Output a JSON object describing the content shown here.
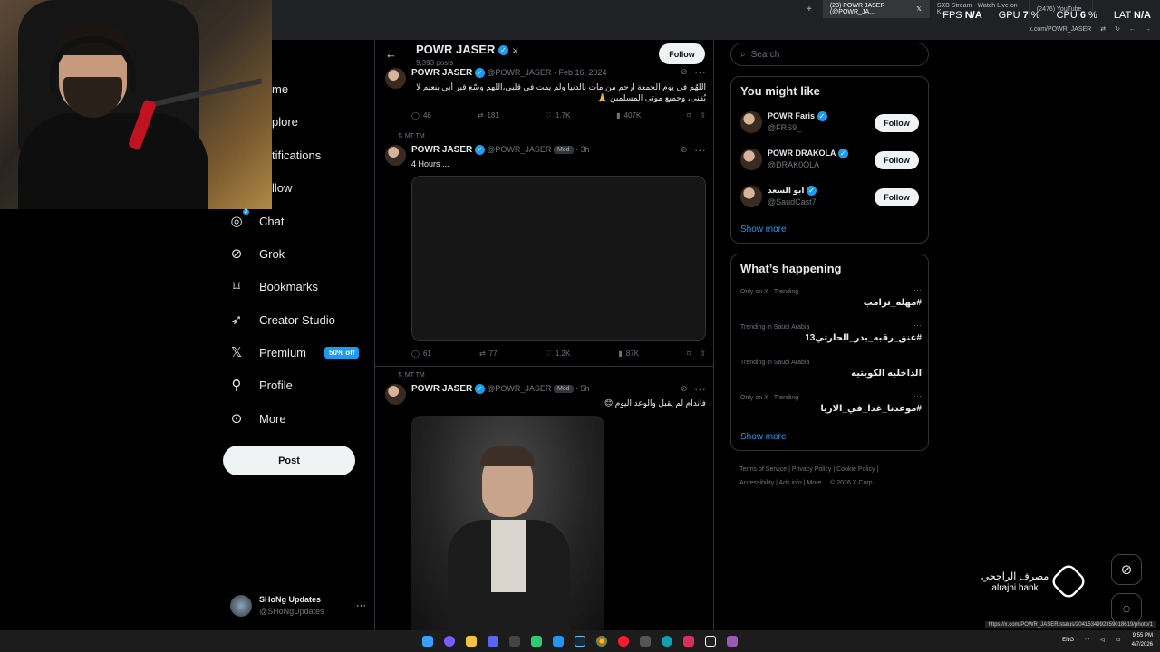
{
  "browser": {
    "tabs": [
      {
        "label": "(23) POWR JASER (@POWR_JA...",
        "active": true
      },
      {
        "label": "SXB Stream - Watch Live on K...",
        "active": false
      },
      {
        "label": "(2476) YouTube",
        "active": false
      }
    ],
    "url": "x.com/POWR_JASER",
    "hover_url": "https://x.com/POWR_JASER/status/2041534992359018619/photo/1",
    "stats": {
      "fps_label": "FPS",
      "fps": "N/A",
      "gpu_label": "GPU",
      "gpu": "7",
      "gpu_unit": "%",
      "cpu_label": "CPU",
      "cpu": "6",
      "cpu_unit": "%",
      "lat_label": "LAT",
      "lat": "N/A"
    }
  },
  "nav": {
    "items": [
      {
        "label": "me",
        "icon": "home-icon"
      },
      {
        "label": "plore",
        "icon": "explore-icon"
      },
      {
        "label": "tifications",
        "icon": "bell-icon"
      },
      {
        "label": "llow",
        "icon": "follow-icon"
      },
      {
        "label": "Chat",
        "icon": "chat-icon"
      },
      {
        "label": "Grok",
        "icon": "grok-icon"
      },
      {
        "label": "Bookmarks",
        "icon": "bookmark-icon"
      },
      {
        "label": "Creator Studio",
        "icon": "rocket-icon"
      },
      {
        "label": "Premium",
        "icon": "x-logo-icon",
        "badge": "50% off"
      },
      {
        "label": "Profile",
        "icon": "person-icon"
      },
      {
        "label": "More",
        "icon": "more-circle-icon"
      }
    ],
    "chat_badge": "3",
    "post_label": "Post",
    "account": {
      "name": "SHoNg Updates",
      "handle": "@SHoNgUpdates"
    }
  },
  "profile_header": {
    "name": "POWR JASER",
    "posts": "9,393 posts",
    "follow_label": "Follow"
  },
  "tweets": [
    {
      "name": "POWR JASER",
      "handle": "@POWR_JASER",
      "time": "Feb 16, 2024",
      "text": "اللهُم في يوم الجمعة ارحم من مات بالدنيا ولم يمت في قلبي،اللهم وسّع قبر أبي بنعيم لا يُفنى، وجميع موتى المسلمين 🙏",
      "replies": "46",
      "reposts": "181",
      "likes": "1.7K",
      "views": "407K"
    },
    {
      "repost_label": "MT TM",
      "name": "POWR JASER",
      "handle": "@POWR_JASER",
      "chip": "Mod",
      "time": "3h",
      "text": "4 Hours ...",
      "replies": "61",
      "reposts": "77",
      "likes": "1.2K",
      "views": "87K"
    },
    {
      "repost_label": "MT TM",
      "name": "POWR JASER",
      "handle": "@POWR_JASER",
      "chip": "Mod",
      "time": "5h",
      "text": "فاندام لم يقبل والوعد اليوم 😊"
    }
  ],
  "search": {
    "placeholder": "Search"
  },
  "you_might_like": {
    "title": "You might like",
    "users": [
      {
        "name": "POWR Faris",
        "handle": "@FRS9_",
        "button": "Follow"
      },
      {
        "name": "POWR DRAKOLA",
        "handle": "@DRAK0OLA",
        "button": "Follow"
      },
      {
        "name": "ابو السعد",
        "handle": "@SaudCast7",
        "button": "Follow"
      }
    ],
    "show_more": "Show more"
  },
  "whats_happening": {
    "title": "What’s happening",
    "trends": [
      {
        "context": "Only on X · Trending",
        "topic": "#مهله_ترامب"
      },
      {
        "context": "Trending in Saudi Arabia",
        "topic": "#عنق_رقبه_بدر_الحارثي13"
      },
      {
        "context": "Trending in Saudi Arabia",
        "topic": "الداخليه الكويتيه"
      },
      {
        "context": "Only on X · Trending",
        "topic": "#موعدنا_غدا_في_الاريا"
      }
    ],
    "show_more": "Show more"
  },
  "footer": {
    "links": [
      "Terms of Service",
      "Privacy Policy",
      "Cookie Policy",
      "Accessibility",
      "Ads info",
      "More ...",
      "© 2026 X Corp."
    ]
  },
  "sponsor": {
    "arabic": "مصرف الراجحي",
    "latin": "alrajhi bank"
  },
  "tray": {
    "lang": "ENG",
    "time": "9:55 PM",
    "date": "4/7/2026"
  },
  "colors": {
    "accent": "#1d9bf0",
    "background": "#000000",
    "border": "#2f3336",
    "muted": "#71767b"
  }
}
